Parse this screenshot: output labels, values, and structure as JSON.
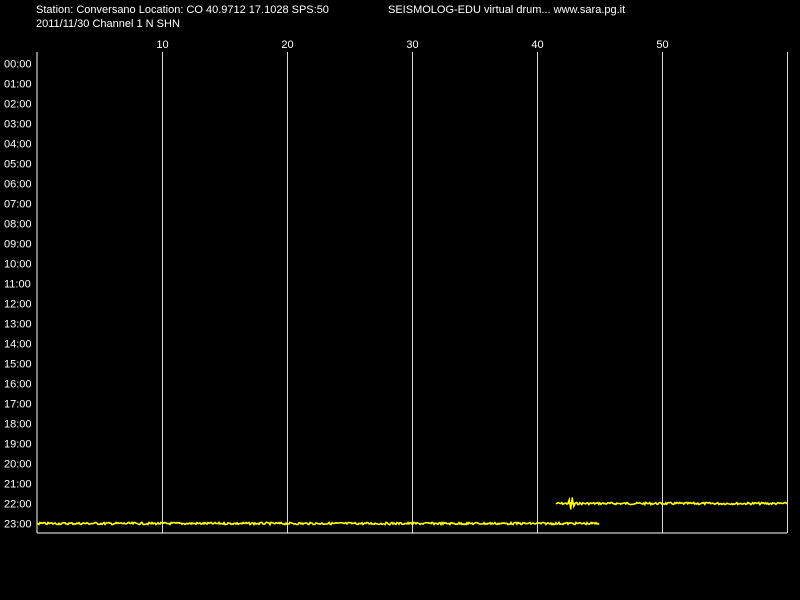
{
  "header": {
    "station_line": "Station: Conversano Location: CO 40.9712 17.1028 SPS:50",
    "channel_line": "2011/11/30  Channel 1 N SHN",
    "brand_line": "SEISMOLOG-EDU virtual drum... www.sara.pg.it"
  },
  "colors": {
    "background": "#000000",
    "text": "#ffffff",
    "grid": "#ffffff",
    "trace": "#ffff00"
  },
  "chart_data": {
    "type": "line",
    "title": "",
    "xlabel": "",
    "ylabel": "",
    "x_unit_implied": "minutes",
    "xlim": [
      0,
      60
    ],
    "x_ticks": [
      10,
      20,
      30,
      40,
      50
    ],
    "hour_labels": [
      "00:00",
      "01:00",
      "02:00",
      "03:00",
      "04:00",
      "05:00",
      "06:00",
      "07:00",
      "08:00",
      "09:00",
      "10:00",
      "11:00",
      "12:00",
      "13:00",
      "14:00",
      "15:00",
      "16:00",
      "17:00",
      "18:00",
      "19:00",
      "20:00",
      "21:00",
      "22:00",
      "23:00"
    ],
    "grid": "vertical lines at x ticks",
    "series": [
      {
        "hour": "22:00",
        "x_start": 41.5,
        "x_end": 60,
        "event_at": 42.7
      },
      {
        "hour": "23:00",
        "x_start": 0,
        "x_end": 45,
        "event_at": null
      }
    ]
  }
}
